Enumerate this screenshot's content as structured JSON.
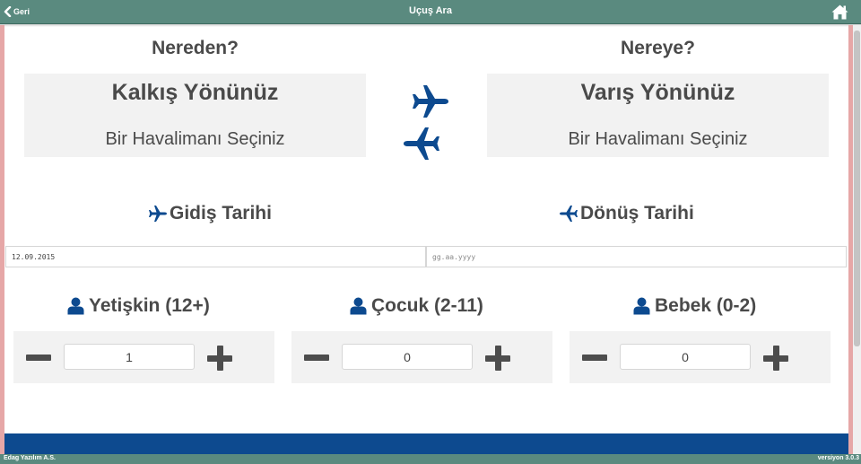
{
  "header": {
    "back_label": "Geri",
    "title": "Uçuş Ara",
    "back_icon": "chevron-left-icon",
    "home_icon": "home-icon"
  },
  "origin": {
    "heading": "Nereden?",
    "title": "Kalkış Yönünüz",
    "subtitle": "Bir Havalimanı Seçiniz"
  },
  "destination": {
    "heading": "Nereye?",
    "title": "Varış Yönünüz",
    "subtitle": "Bir Havalimanı Seçiniz"
  },
  "dates": {
    "departure_label": "Gidiş Tarihi",
    "departure_value": "12.09.2015",
    "return_label": "Dönüş Tarihi",
    "return_placeholder": "gg.aa.yyyy",
    "icon": "plane-icon"
  },
  "passengers": [
    {
      "label": "Yetişkin (12+)",
      "count": "1"
    },
    {
      "label": "Çocuk (2-11)",
      "count": "0"
    },
    {
      "label": "Bebek (0-2)",
      "count": "0"
    }
  ],
  "footer": {
    "company": "Edag Yazılım A.S.",
    "version": "versiyon 3.0.3"
  },
  "colors": {
    "header_bg": "#5a8a7f",
    "accent_blue": "#0d4a8f",
    "panel_bg": "#f2f2f2",
    "side_edge": "#e6a7a7"
  }
}
